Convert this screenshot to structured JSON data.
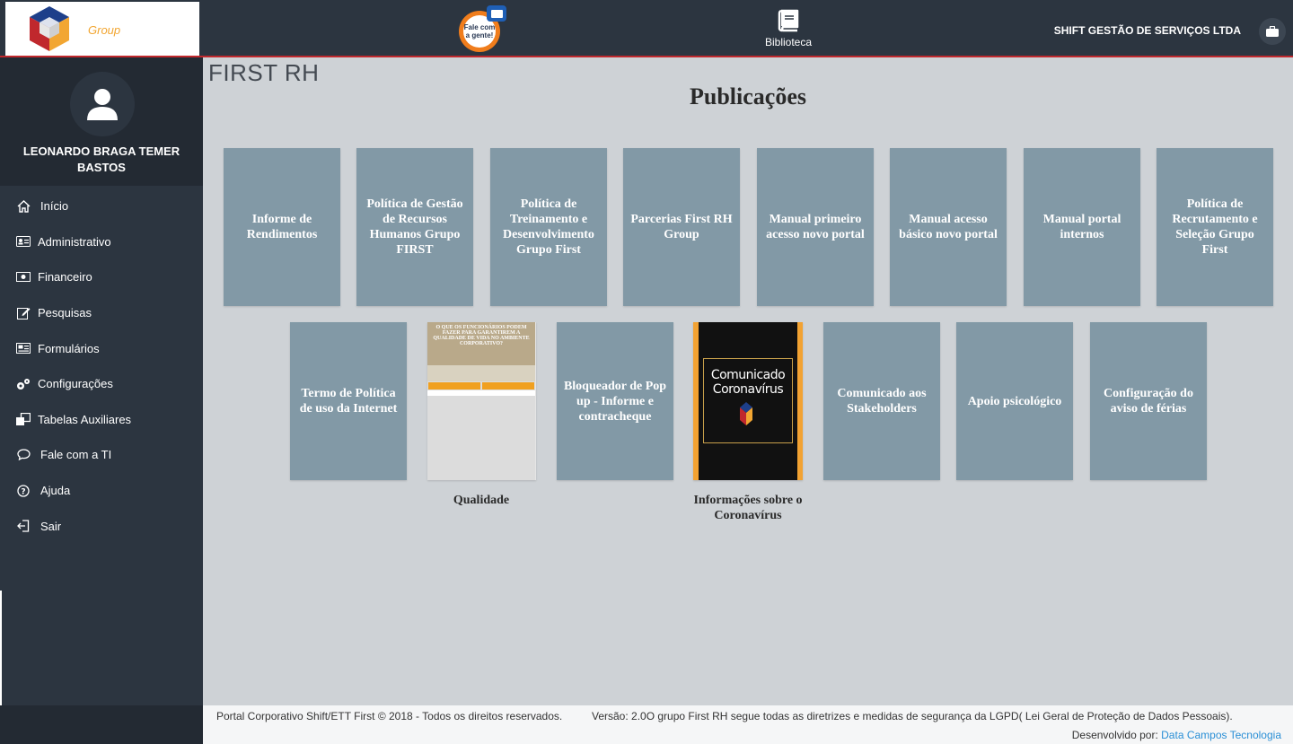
{
  "brand": {
    "name": "FIRST RH",
    "sub": "Group"
  },
  "header": {
    "fale_text": "Fale com a gente!",
    "biblioteca_label": "Biblioteca",
    "company": "SHIFT GESTÃO DE SERVIÇOS LTDA"
  },
  "user": {
    "name": "LEONARDO BRAGA TEMER BASTOS"
  },
  "sidebar": {
    "items": [
      {
        "label": "Início",
        "icon": "home-icon"
      },
      {
        "label": "Administrativo",
        "icon": "id-card-icon"
      },
      {
        "label": "Financeiro",
        "icon": "money-icon"
      },
      {
        "label": "Pesquisas",
        "icon": "edit-icon"
      },
      {
        "label": "Formulários",
        "icon": "newspaper-icon"
      },
      {
        "label": "Configurações",
        "icon": "cogs-icon"
      },
      {
        "label": "Tabelas Auxiliares",
        "icon": "clone-icon"
      },
      {
        "label": "Fale com a TI",
        "icon": "chat-icon"
      },
      {
        "label": "Ajuda",
        "icon": "question-icon"
      },
      {
        "label": "Sair",
        "icon": "sign-out-icon"
      }
    ]
  },
  "page": {
    "title": "Publicações"
  },
  "publications": {
    "row1": [
      "Informe de Rendimentos",
      "Política de Gestão de Recursos Humanos Grupo FIRST",
      "Política de Treinamento e Desenvolvimento Grupo First",
      "Parcerias First RH Group",
      "Manual primeiro acesso novo portal",
      "Manual acesso básico novo portal",
      "Manual portal internos",
      "Política de Recrutamento e Seleção Grupo First"
    ],
    "row2": {
      "termo": "Termo de Política de uso da Internet",
      "qualidade_caption": "Qualidade",
      "qualidade_thumb_text": "O QUE OS FUNCIONÁRIOS PODEM FAZER PARA GARANTIREM A QUALIDADE DE VIDA NO AMBIENTE CORPORATIVO?",
      "bloqueador": "Bloqueador de Pop up - Informe e contracheque",
      "corona_caption": "Informações sobre o Coronavírus",
      "corona_thumb_text": "Comunicado Coronavírus",
      "stakeholders": "Comunicado aos Stakeholders",
      "apoio": "Apoio psicológico",
      "ferias": "Configuração do aviso de férias"
    }
  },
  "footer": {
    "copyright": "Portal Corporativo Shift/ETT First © 2018 - Todos os direitos reservados.",
    "version": "Versão: 2.0O grupo First RH segue todas as diretrizes e medidas de segurança da LGPD( Lei Geral de Proteção de Dados Pessoais).",
    "dev_prefix": "Desenvolvido por:",
    "dev_link": "Data Campos Tecnologia"
  }
}
